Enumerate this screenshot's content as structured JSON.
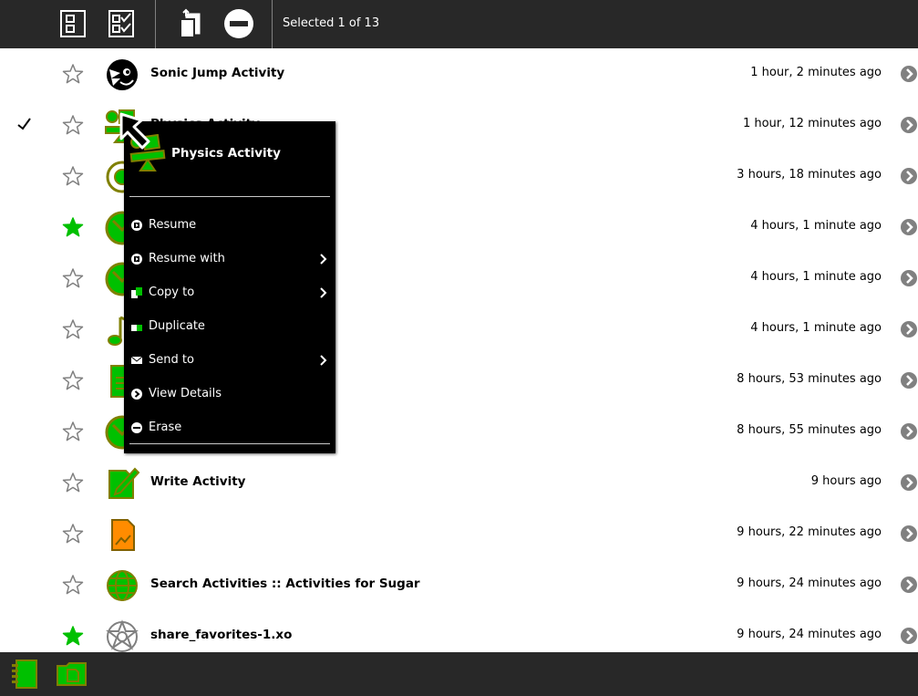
{
  "toolbar": {
    "status": "Selected 1 of 13",
    "buttons": [
      "select-none",
      "select-all",
      "copy",
      "erase"
    ]
  },
  "rows": [
    {
      "title": "Sonic Jump Activity",
      "time": "1 hour, 2 minutes ago",
      "starred": false,
      "checked": false,
      "icon": "sonic-icon"
    },
    {
      "title": "Physics Activity",
      "time": "1 hour, 12 minutes ago",
      "starred": false,
      "checked": true,
      "icon": "physics-icon"
    },
    {
      "title": "",
      "time": "3 hours, 18 minutes ago",
      "starred": false,
      "checked": false,
      "icon": "ring-icon"
    },
    {
      "title": "",
      "time": "4 hours, 1 minute ago",
      "starred": true,
      "checked": false,
      "icon": "round-activity-icon"
    },
    {
      "title": "",
      "time": "4 hours, 1 minute ago",
      "starred": false,
      "checked": false,
      "icon": "round-activity-icon"
    },
    {
      "title": "",
      "time": "4 hours, 1 minute ago",
      "starred": false,
      "checked": false,
      "icon": "music-note-icon"
    },
    {
      "title": "",
      "time": "8 hours, 53 minutes ago",
      "starred": false,
      "checked": false,
      "icon": "document-icon"
    },
    {
      "title": "",
      "time": "8 hours, 55 minutes ago",
      "starred": false,
      "checked": false,
      "icon": "round-activity-icon"
    },
    {
      "title": "Write Activity",
      "time": "9 hours ago",
      "starred": false,
      "checked": false,
      "icon": "write-icon"
    },
    {
      "title": "",
      "time": "9 hours, 22 minutes ago",
      "starred": false,
      "checked": false,
      "icon": "image-file-icon"
    },
    {
      "title": "Search Activities :: Activities for Sugar",
      "time": "9 hours, 24 minutes ago",
      "starred": false,
      "checked": false,
      "icon": "globe-icon"
    },
    {
      "title": "share_favorites-1.xo",
      "time": "9 hours, 24 minutes ago",
      "starred": true,
      "checked": false,
      "icon": "bundle-icon"
    }
  ],
  "palette": {
    "title": "Physics Activity",
    "items": [
      {
        "label": "Resume",
        "icon": "resume-icon",
        "submenu": false
      },
      {
        "label": "Resume with",
        "icon": "resume-icon",
        "submenu": true
      },
      {
        "label": "Copy to",
        "icon": "copy-icon",
        "submenu": true
      },
      {
        "label": "Duplicate",
        "icon": "duplicate-icon",
        "submenu": false
      },
      {
        "label": "Send to",
        "icon": "envelope-icon",
        "submenu": true
      },
      {
        "label": "View Details",
        "icon": "details-icon",
        "submenu": false
      },
      {
        "label": "Erase",
        "icon": "erase-icon",
        "submenu": false
      }
    ]
  },
  "bottombar": {
    "buttons": [
      "journal-icon",
      "documents-folder-icon"
    ]
  },
  "colors": {
    "bar": "#282828",
    "activity_fill": "#00c000",
    "activity_stroke": "#808000",
    "star_fill": "#00c000",
    "doc_fill": "#ff8c00"
  }
}
